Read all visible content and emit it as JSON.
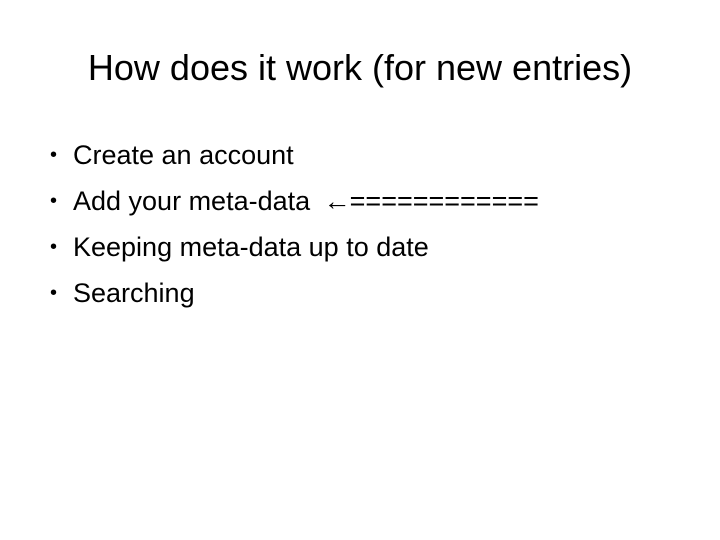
{
  "slide": {
    "title": "How does it work (for new entries)",
    "bullet_glyph": "•",
    "items": [
      {
        "text": "Create an account"
      },
      {
        "text": "Add your meta-data",
        "arrow": "←",
        "suffix": "============"
      },
      {
        "text": "Keeping meta-data up to date"
      },
      {
        "text": "Searching"
      }
    ]
  }
}
